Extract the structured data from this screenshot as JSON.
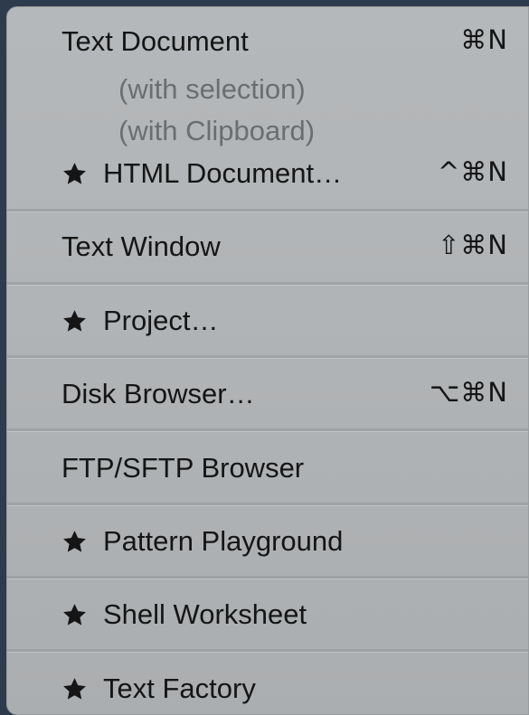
{
  "menu": {
    "items": [
      {
        "label": "Text Document",
        "shortcut": "⌘N"
      },
      {
        "label": "(with selection)"
      },
      {
        "label": "(with Clipboard)"
      },
      {
        "label": "HTML Document…",
        "shortcut": "^⌘N",
        "icon": "star-icon"
      },
      {
        "label": "Text Window",
        "shortcut": "⇧⌘N"
      },
      {
        "label": "Project…",
        "icon": "star-icon"
      },
      {
        "label": "Disk Browser…",
        "shortcut": "⌥⌘N"
      },
      {
        "label": "FTP/SFTP Browser"
      },
      {
        "label": "Pattern Playground",
        "icon": "star-icon"
      },
      {
        "label": "Shell Worksheet",
        "icon": "star-icon"
      },
      {
        "label": "Text Factory",
        "icon": "star-icon"
      }
    ]
  },
  "colors": {
    "menu_background": "#b3b6b8",
    "text": "#151515",
    "disabled_text": "#6b6e70",
    "separator": "#9fa2a4"
  }
}
